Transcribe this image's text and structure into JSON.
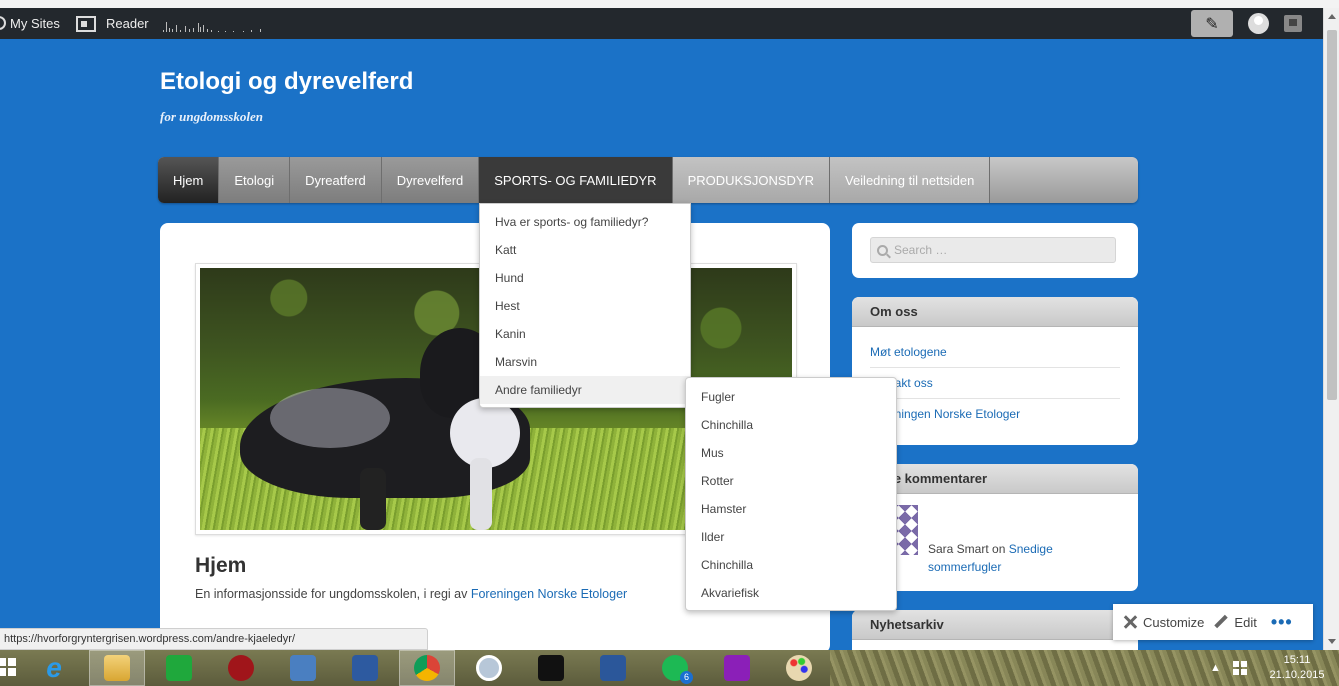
{
  "admin_bar": {
    "my_sites": "My Sites",
    "reader": "Reader"
  },
  "site": {
    "title": "Etologi og dyrevelferd",
    "description": "for ungdomsskolen"
  },
  "nav": {
    "items": [
      "Hjem",
      "Etologi",
      "Dyreatferd",
      "Dyrevelferd",
      "SPORTS- OG FAMILIEDYR",
      "PRODUKSJONSDYR",
      "Veiledning til nettsiden"
    ]
  },
  "dropdown": {
    "items": [
      "Hva er sports- og familiedyr?",
      "Katt",
      "Hund",
      "Hest",
      "Kanin",
      "Marsvin",
      "Andre familiedyr"
    ],
    "submenu": [
      "Fugler",
      "Chinchilla",
      "Mus",
      "Rotter",
      "Hamster",
      "Ilder",
      "Chinchilla",
      "Akvariefisk"
    ]
  },
  "page": {
    "title": "Hjem",
    "text": "En informasjonsside for ungdomsskolen, i regi av ",
    "link": "Foreningen Norske Etologer"
  },
  "sidebar": {
    "search_placeholder": "Search …",
    "om_oss": {
      "title": "Om oss",
      "links": [
        "Møt etologene",
        "Kontakt oss",
        "Foreningen Norske Etologer"
      ]
    },
    "kommentarer": {
      "title": "Siste kommentarer",
      "author": "Sara Smart",
      "on": "on",
      "post": "Snedige sommerfugler"
    },
    "nyhetsarkiv": "Nyhetsarkiv"
  },
  "customize_bar": {
    "customize": "Customize",
    "edit": "Edit",
    "more": "•••"
  },
  "status_url": "https://hvorforgryntergrisen.wordpress.com/andre-kjaeledyr/",
  "taskbar": {
    "spotify_badge": "6",
    "time": "15:11",
    "date": "21.10.2015"
  }
}
